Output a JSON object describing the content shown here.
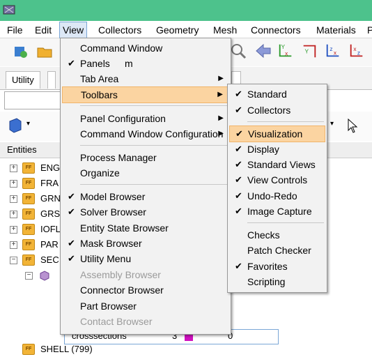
{
  "menubar": {
    "items": [
      "File",
      "Edit",
      "View",
      "Collectors",
      "Geometry",
      "Mesh",
      "Connectors",
      "Materials",
      "P"
    ]
  },
  "tabs": {
    "utility": "Utility"
  },
  "entities_header": "Entities",
  "tree": {
    "rows": [
      "ENG",
      "FRA",
      "GRN",
      "GRS",
      "IOFL",
      "PAR",
      "SEC",
      "",
      "",
      "",
      "crosssections",
      "SHELL (799)"
    ],
    "crosssections_count": "3",
    "crosssections_col": "0"
  },
  "view_menu": {
    "items": [
      {
        "label": "Command Window",
        "check": "",
        "arrow": ""
      },
      {
        "label": "Panels",
        "shortcut": "m",
        "check": "✔",
        "arrow": ""
      },
      {
        "label": "Tab Area",
        "check": "",
        "arrow": "▶"
      },
      {
        "label": "Toolbars",
        "check": "",
        "arrow": "▶"
      },
      {
        "label": "Panel Configuration",
        "check": "",
        "arrow": "▶"
      },
      {
        "label": "Command Window Configuration",
        "check": "",
        "arrow": "▶"
      },
      {
        "label": "Process Manager",
        "check": "",
        "arrow": ""
      },
      {
        "label": "Organize",
        "check": "",
        "arrow": ""
      },
      {
        "label": "Model Browser",
        "check": "✔",
        "arrow": ""
      },
      {
        "label": "Solver Browser",
        "check": "✔",
        "arrow": ""
      },
      {
        "label": "Entity State Browser",
        "check": "",
        "arrow": ""
      },
      {
        "label": "Mask Browser",
        "check": "✔",
        "arrow": ""
      },
      {
        "label": "Utility Menu",
        "check": "✔",
        "arrow": ""
      },
      {
        "label": "Assembly Browser",
        "check": "",
        "arrow": ""
      },
      {
        "label": "Connector Browser",
        "check": "",
        "arrow": ""
      },
      {
        "label": "Part Browser",
        "check": "",
        "arrow": ""
      },
      {
        "label": "Contact Browser",
        "check": "",
        "arrow": ""
      }
    ]
  },
  "toolbars_menu": {
    "items": [
      {
        "label": "Standard",
        "check": "✔"
      },
      {
        "label": "Collectors",
        "check": "✔"
      },
      {
        "label": "Visualization",
        "check": "✔"
      },
      {
        "label": "Display",
        "check": "✔"
      },
      {
        "label": "Standard Views",
        "check": "✔"
      },
      {
        "label": "View Controls",
        "check": "✔"
      },
      {
        "label": "Undo-Redo",
        "check": "✔"
      },
      {
        "label": "Image Capture",
        "check": "✔"
      },
      {
        "label": "Checks",
        "check": ""
      },
      {
        "label": "Patch Checker",
        "check": ""
      },
      {
        "label": "Favorites",
        "check": "✔"
      },
      {
        "label": "Scripting",
        "check": ""
      }
    ]
  },
  "colors": {
    "titlebar": "#4dc28c",
    "highlight": "#fbd4a1",
    "folder": "#f2b437"
  }
}
